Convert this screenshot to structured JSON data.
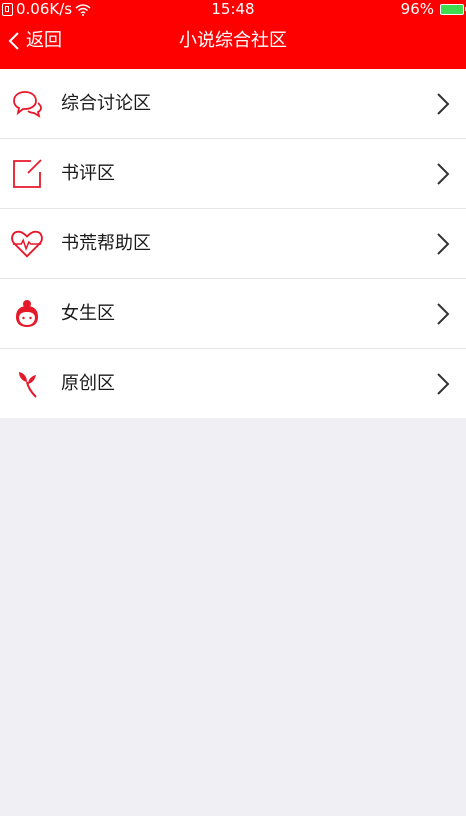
{
  "status_bar": {
    "network_speed": "0.06K/s",
    "time": "15:48",
    "battery": "96%"
  },
  "nav": {
    "back_label": "返回",
    "title": "小说综合社区"
  },
  "colors": {
    "accent": "#ff0000",
    "background": "#efeff4"
  },
  "list": {
    "items": [
      {
        "label": "综合讨论区",
        "icon": "chat-bubbles-icon"
      },
      {
        "label": "书评区",
        "icon": "edit-square-icon"
      },
      {
        "label": "书荒帮助区",
        "icon": "heart-pulse-icon"
      },
      {
        "label": "女生区",
        "icon": "girl-face-icon"
      },
      {
        "label": "原创区",
        "icon": "leaf-sprout-icon"
      }
    ]
  }
}
